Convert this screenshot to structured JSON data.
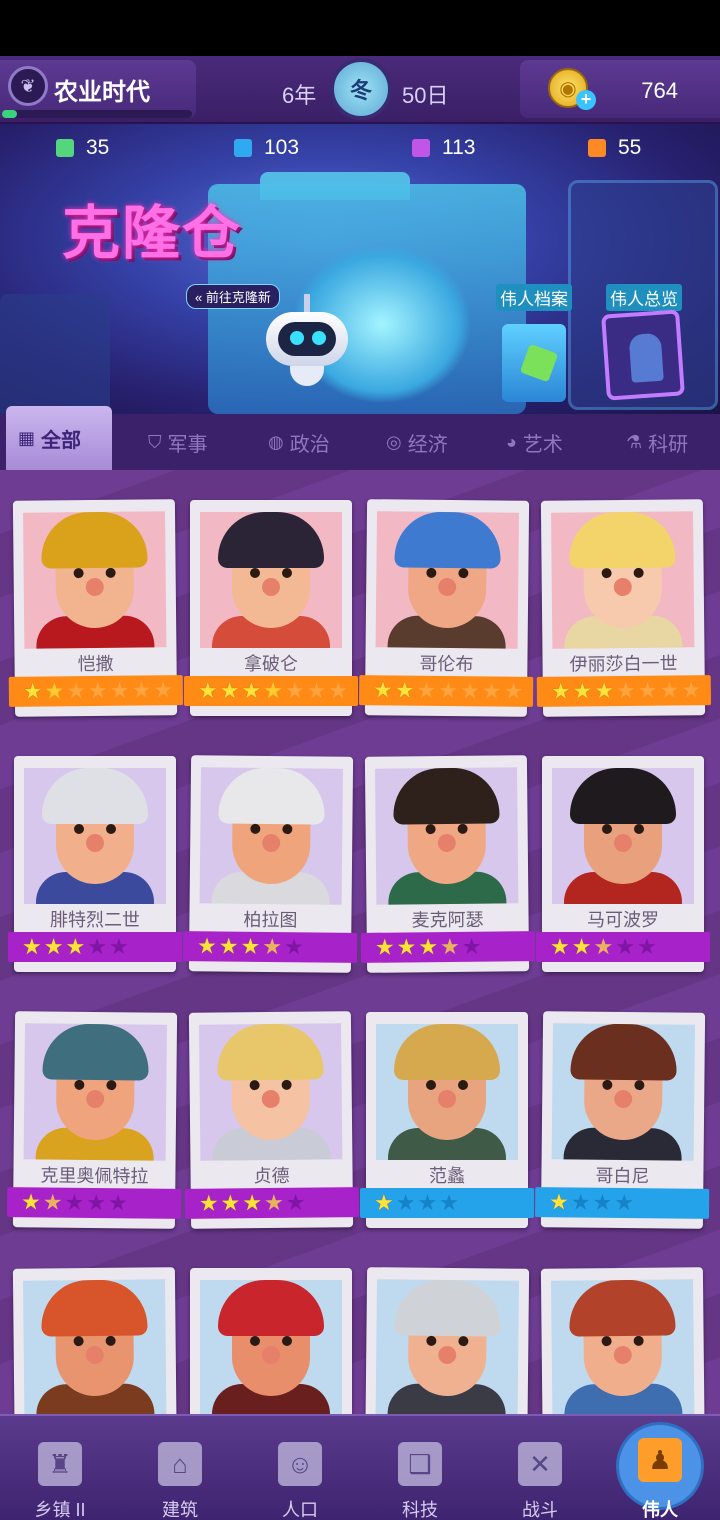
{
  "topbar": {
    "era_name": "农业时代",
    "year": "6年",
    "season": "冬",
    "day": "50日",
    "coins": "764",
    "era_progress": 0.08
  },
  "resources": [
    {
      "value": "35",
      "color": "#55d67d"
    },
    {
      "value": "103",
      "color": "#2fa9ef"
    },
    {
      "value": "113",
      "color": "#c155e8"
    },
    {
      "value": "55",
      "color": "#ff8a24"
    }
  ],
  "banner": {
    "title": "克隆仓",
    "link": "前往克隆新",
    "hero_files": "伟人档案",
    "hero_overview": "伟人总览"
  },
  "tabs": [
    {
      "label": "全部",
      "icon": "grid-icon"
    },
    {
      "label": "军事",
      "icon": "shield-icon"
    },
    {
      "label": "政治",
      "icon": "globe-icon"
    },
    {
      "label": "经济",
      "icon": "coins-icon"
    },
    {
      "label": "艺术",
      "icon": "palette-icon"
    },
    {
      "label": "科研",
      "icon": "flask-icon"
    }
  ],
  "heroes": [
    {
      "name": "恺撒",
      "rarity": "orange",
      "rating": 1.5,
      "max": 7,
      "bg": "#f2b8c4",
      "hair": "#d9a21a",
      "skin": "#f1b48f",
      "cloth": "#b8191e"
    },
    {
      "name": "拿破仑",
      "rarity": "orange",
      "rating": 3.5,
      "max": 7,
      "bg": "#f2b8c4",
      "hair": "#2b2336",
      "skin": "#f3b894",
      "cloth": "#d64c3b"
    },
    {
      "name": "哥伦布",
      "rarity": "orange",
      "rating": 2,
      "max": 7,
      "bg": "#f2b8c4",
      "hair": "#3e7bd0",
      "skin": "#efa786",
      "cloth": "#5a3c2e"
    },
    {
      "name": "伊丽莎白一世",
      "rarity": "orange",
      "rating": 3,
      "max": 7,
      "bg": "#f2b8c4",
      "hair": "#f2d46a",
      "skin": "#f7c9ad",
      "cloth": "#e8d7a2"
    },
    {
      "name": "腓特烈二世",
      "rarity": "purple",
      "rating": 3,
      "max": 5,
      "bg": "#d7c7ec",
      "hair": "#dfe0e6",
      "skin": "#f1b08b",
      "cloth": "#3c4a9e"
    },
    {
      "name": "柏拉图",
      "rarity": "purple",
      "rating": 3.5,
      "max": 5,
      "bg": "#d7c7ec",
      "hair": "#e8e8ea",
      "skin": "#f0a47c",
      "cloth": "#d9d9de"
    },
    {
      "name": "麦克阿瑟",
      "rarity": "purple",
      "rating": 3.5,
      "max": 5,
      "bg": "#d7c7ec",
      "hair": "#2e201a",
      "skin": "#efa883",
      "cloth": "#2c6a4a"
    },
    {
      "name": "马可波罗",
      "rarity": "purple",
      "rating": 2.5,
      "max": 5,
      "bg": "#d7c7ec",
      "hair": "#1f1a1d",
      "skin": "#e9a07d",
      "cloth": "#b3251f"
    },
    {
      "name": "克里奥佩特拉",
      "rarity": "purple",
      "rating": 1.5,
      "max": 5,
      "bg": "#d7c7ec",
      "hair": "#3f6f7f",
      "skin": "#efa47e",
      "cloth": "#d9a31f"
    },
    {
      "name": "贞德",
      "rarity": "purple",
      "rating": 3.5,
      "max": 5,
      "bg": "#d7c7ec",
      "hair": "#e8c66a",
      "skin": "#f5c2a4",
      "cloth": "#c9ccd6"
    },
    {
      "name": "范蠡",
      "rarity": "blue",
      "rating": 1,
      "max": 4,
      "bg": "#bfd9ee",
      "hair": "#d6a94f",
      "skin": "#e8a37f",
      "cloth": "#3f5a47"
    },
    {
      "name": "哥白尼",
      "rarity": "blue",
      "rating": 1,
      "max": 4,
      "bg": "#bfd9ee",
      "hair": "#6a2f1f",
      "skin": "#eaa888",
      "cloth": "#2a2a36"
    },
    {
      "name": "",
      "rarity": "",
      "rating": 0,
      "max": 0,
      "bg": "#bfd9ee",
      "hair": "#d8542a",
      "skin": "#e8946f",
      "cloth": "#7a3b1e"
    },
    {
      "name": "",
      "rarity": "",
      "rating": 0,
      "max": 0,
      "bg": "#bfd9ee",
      "hair": "#c8252d",
      "skin": "#e88e6a",
      "cloth": "#6a1f1f"
    },
    {
      "name": "",
      "rarity": "",
      "rating": 0,
      "max": 0,
      "bg": "#bfd9ee",
      "hair": "#cfd3d8",
      "skin": "#efb190",
      "cloth": "#3b3b46"
    },
    {
      "name": "",
      "rarity": "",
      "rating": 0,
      "max": 0,
      "bg": "#bfd9ee",
      "hair": "#b2432a",
      "skin": "#f1ae8c",
      "cloth": "#3e6db0"
    }
  ],
  "nav": [
    {
      "label": "乡镇 II",
      "icon": "castle-icon",
      "active": false
    },
    {
      "label": "建筑",
      "icon": "house-icon",
      "active": false
    },
    {
      "label": "人口",
      "icon": "person-icon",
      "active": false
    },
    {
      "label": "科技",
      "icon": "book-icon",
      "active": false
    },
    {
      "label": "战斗",
      "icon": "swords-icon",
      "active": false
    },
    {
      "label": "伟人",
      "icon": "bust-icon",
      "active": true
    }
  ]
}
